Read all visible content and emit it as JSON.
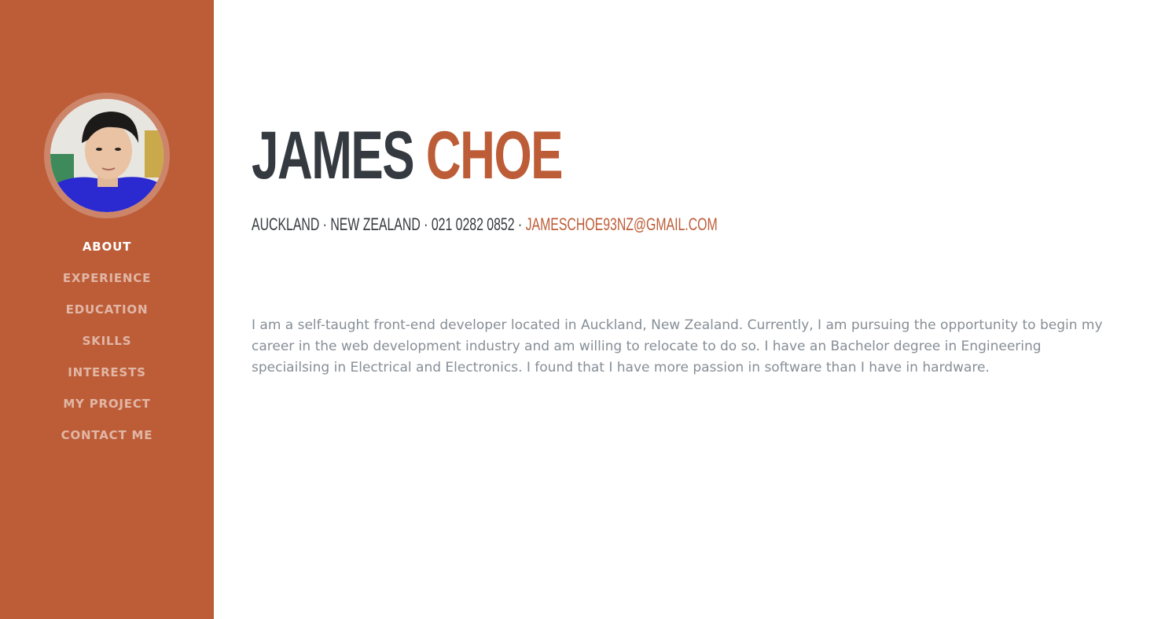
{
  "profile": {
    "first_name": "JAMES",
    "last_name": "CHOE",
    "location": "AUCKLAND · NEW ZEALAND · 021 0282 0852 ·",
    "email": "JAMESCHOE93NZ@GMAIL.COM",
    "bio": "I am a self-taught front-end developer located in Auckland, New Zealand. Currently, I am pursuing the opportunity to begin my career in the web development industry and am willing to relocate to do so. I have an Bachelor degree in Engineering speciailsing in Electrical and Electronics. I found that I have more passion in software than I have in hardware."
  },
  "sidebar": {
    "avatar_icon": "profile-photo",
    "items": [
      {
        "label": "ABOUT",
        "active": true
      },
      {
        "label": "EXPERIENCE",
        "active": false
      },
      {
        "label": "EDUCATION",
        "active": false
      },
      {
        "label": "SKILLS",
        "active": false
      },
      {
        "label": "INTERESTS",
        "active": false
      },
      {
        "label": "MY PROJECT",
        "active": false
      },
      {
        "label": "CONTACT ME",
        "active": false
      }
    ]
  },
  "colors": {
    "primary": "#bd5d38",
    "heading": "#343a40",
    "body_text": "#868e96"
  }
}
